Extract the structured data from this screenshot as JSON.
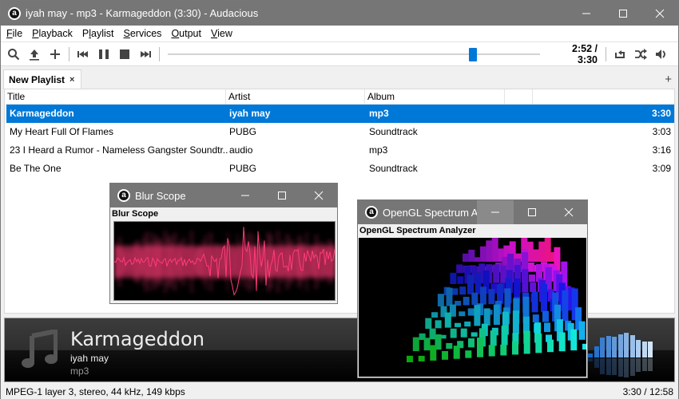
{
  "window": {
    "title": "iyah may - mp3 - Karmageddon (3:30) - Audacious",
    "logo_glyph": "a"
  },
  "menu": [
    {
      "label": "File",
      "mnemonic": "F",
      "rest": "ile"
    },
    {
      "label": "Playback",
      "mnemonic": "P",
      "rest": "layback"
    },
    {
      "label": "Playlist",
      "mnemonic": "l",
      "pre": "P",
      "rest": "aylist"
    },
    {
      "label": "Services",
      "mnemonic": "S",
      "rest": "ervices"
    },
    {
      "label": "Output",
      "mnemonic": "O",
      "rest": "utput"
    },
    {
      "label": "View",
      "mnemonic": "V",
      "rest": "iew"
    }
  ],
  "toolbar": {
    "icons": [
      "search-icon",
      "open-files-icon",
      "add-files-icon",
      "previous-icon",
      "pause-icon",
      "stop-icon",
      "next-icon"
    ],
    "seek_position": 0.819,
    "time_display": "2:52 / 3:30",
    "right_icons": [
      "repeat-icon",
      "shuffle-icon",
      "volume-icon"
    ]
  },
  "tabs": [
    {
      "label": "New Playlist",
      "close": "×",
      "active": true
    }
  ],
  "tab_add": "+",
  "playlist": {
    "columns": [
      "Title",
      "Artist",
      "Album",
      "",
      ""
    ],
    "rows": [
      {
        "title": "Karmageddon",
        "artist": "iyah may",
        "album": "mp3",
        "length": "3:30",
        "selected": true
      },
      {
        "title": "My Heart Full Of Flames",
        "artist": "PUBG",
        "album": "Soundtrack",
        "length": "3:03",
        "selected": false
      },
      {
        "title": "23 I Heard a Rumor - Nameless Gangster Soundtr...",
        "artist": "audio",
        "album": "mp3",
        "length": "3:16",
        "selected": false
      },
      {
        "title": "Be The One",
        "artist": "PUBG",
        "album": "Soundtrack",
        "length": "3:09",
        "selected": false
      }
    ]
  },
  "now_playing": {
    "title": "Karmageddon",
    "artist": "iyah may",
    "album": "mp3",
    "visualizer_levels": [
      0.15,
      0.4,
      0.7,
      0.74,
      0.72,
      0.8,
      0.85,
      0.78,
      0.6,
      0.55,
      0.55
    ]
  },
  "status": {
    "format": "MPEG-1 layer 3, stereo, 44 kHz, 149 kbps",
    "time": "3:30 / 12:58"
  },
  "blur_scope": {
    "window_title": "Blur Scope",
    "label": "Blur Scope",
    "color": "#ff3c78"
  },
  "spectrum": {
    "window_title": "OpenGL Spectrum A...",
    "label": "OpenGL Spectrum Analyzer"
  },
  "colors": {
    "accent": "#0078d7",
    "titlebar": "#767676"
  }
}
